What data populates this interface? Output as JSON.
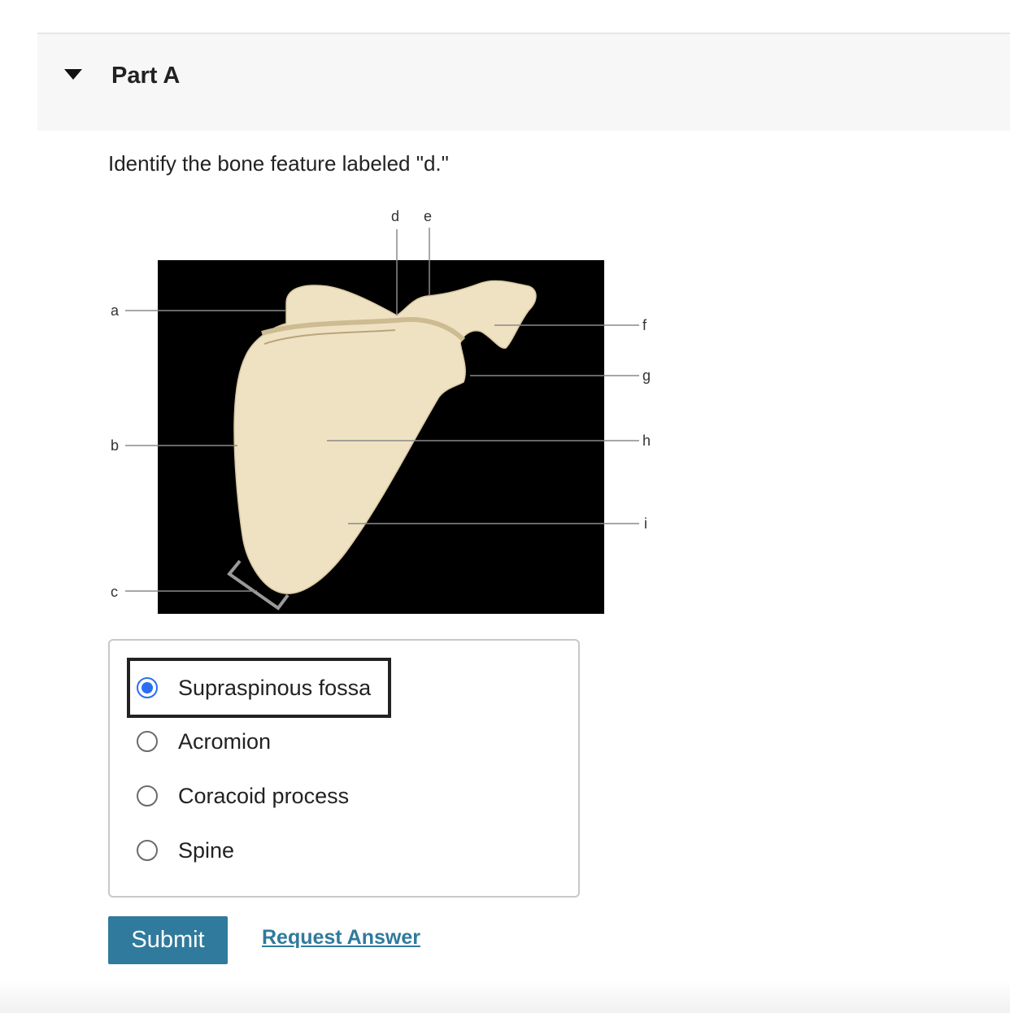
{
  "part": {
    "title": "Part A",
    "expanded": true
  },
  "question": {
    "prompt": "Identify the bone feature labeled \"d.\""
  },
  "figure": {
    "labels": {
      "a": "a",
      "b": "b",
      "c": "c",
      "d": "d",
      "e": "e",
      "f": "f",
      "g": "g",
      "h": "h",
      "i": "i"
    },
    "colors": {
      "background": "#000000",
      "bone": "#efe2c3",
      "leader": "#8a8a8a"
    }
  },
  "choices": [
    {
      "label": "Supraspinous fossa",
      "selected": true
    },
    {
      "label": "Acromion",
      "selected": false
    },
    {
      "label": "Coracoid process",
      "selected": false
    },
    {
      "label": "Spine",
      "selected": false
    }
  ],
  "actions": {
    "submit_label": "Submit",
    "request_answer_label": "Request Answer"
  },
  "colors": {
    "accent": "#2a6ff1",
    "button": "#2f7a9d",
    "link": "#2f7a9d"
  }
}
